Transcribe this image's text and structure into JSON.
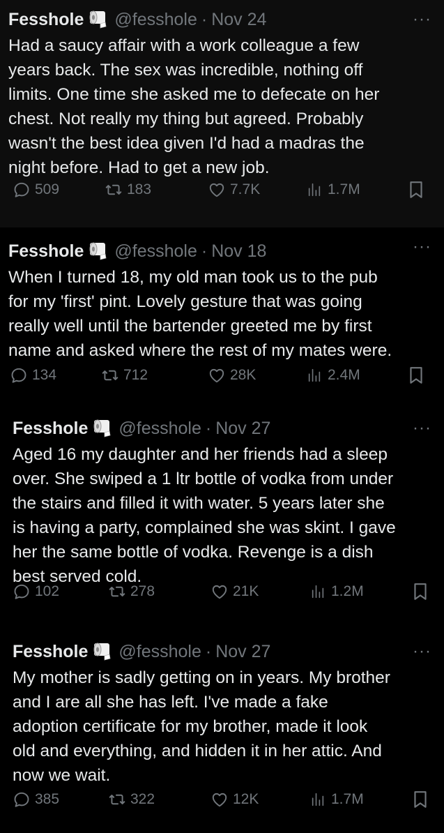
{
  "tweets": [
    {
      "name": "Fesshole",
      "handle": "@fesshole",
      "date": "Nov 24",
      "text": "Had a saucy affair with a work colleague a few\nyears back. The sex was incredible, nothing off\nlimits. One time she asked me to defecate on her\nchest. Not really my thing but agreed. Probably\nwasn't the best idea given I'd had a madras the\nnight before. Had to get a new job.",
      "replies": "509",
      "reposts": "183",
      "likes": "7.7K",
      "views": "1.7M"
    },
    {
      "name": "Fesshole",
      "handle": "@fesshole",
      "date": "Nov 18",
      "text": "When I turned 18, my old man took us to the pub\nfor my 'first' pint. Lovely gesture that was going\nreally well until the bartender greeted me by first\nname and asked where the rest of my mates were.",
      "replies": "134",
      "reposts": "712",
      "likes": "28K",
      "views": "2.4M"
    },
    {
      "name": "Fesshole",
      "handle": "@fesshole",
      "date": "Nov 27",
      "text": "Aged 16 my daughter and her friends had a sleep\nover. She swiped a 1 ltr bottle of vodka from under\nthe stairs and filled it with water. 5 years later she\nis having a party, complained she was skint. I gave\nher the same bottle of vodka. Revenge is a dish\nbest served cold.",
      "replies": "102",
      "reposts": "278",
      "likes": "21K",
      "views": "1.2M"
    },
    {
      "name": "Fesshole",
      "handle": "@fesshole",
      "date": "Nov 27",
      "text": "My mother is sadly getting on in years. My brother\nand I are all she has left. I've made a fake\nadoption certificate for my brother, made it look\nold and everything, and hidden it in her attic. And\nnow we wait.",
      "replies": "385",
      "reposts": "322",
      "likes": "12K",
      "views": "1.7M"
    }
  ],
  "separator": "·",
  "more_glyph": "···",
  "icons": {
    "avatar_badge": "toilet-roll-icon",
    "reply": "reply-icon",
    "repost": "repost-icon",
    "like": "like-icon",
    "views": "views-icon",
    "bookmark": "bookmark-icon"
  },
  "colors": {
    "background": "#000000",
    "text": "#e7e9ea",
    "muted": "#71767b"
  }
}
